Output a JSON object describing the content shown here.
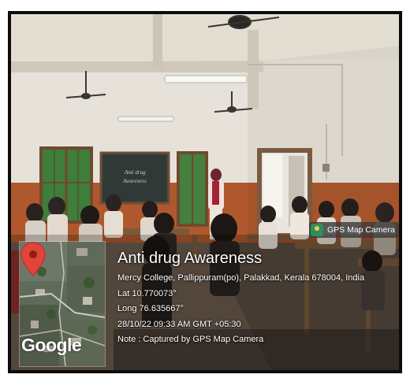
{
  "overlay": {
    "camera_badge": "GPS Map Camera",
    "camera_icon": "gps-map-camera-app-icon",
    "title": "Anti drug Awareness",
    "address": "Mercy College, Pallippuram(po), Palakkad, Kerala 678004, India",
    "lat": "Lat 10.770073°",
    "long": "Long 76.635667°",
    "datetime": "28/10/22 09:33 AM GMT +05:30",
    "note": "Note : Captured by GPS Map Camera"
  },
  "map": {
    "logo": "Google",
    "pin_icon": "map-pin-icon",
    "pin_color": "#e2443a"
  },
  "scene": {
    "blackboard_text": [
      "Anti drug",
      "Awareness"
    ]
  }
}
